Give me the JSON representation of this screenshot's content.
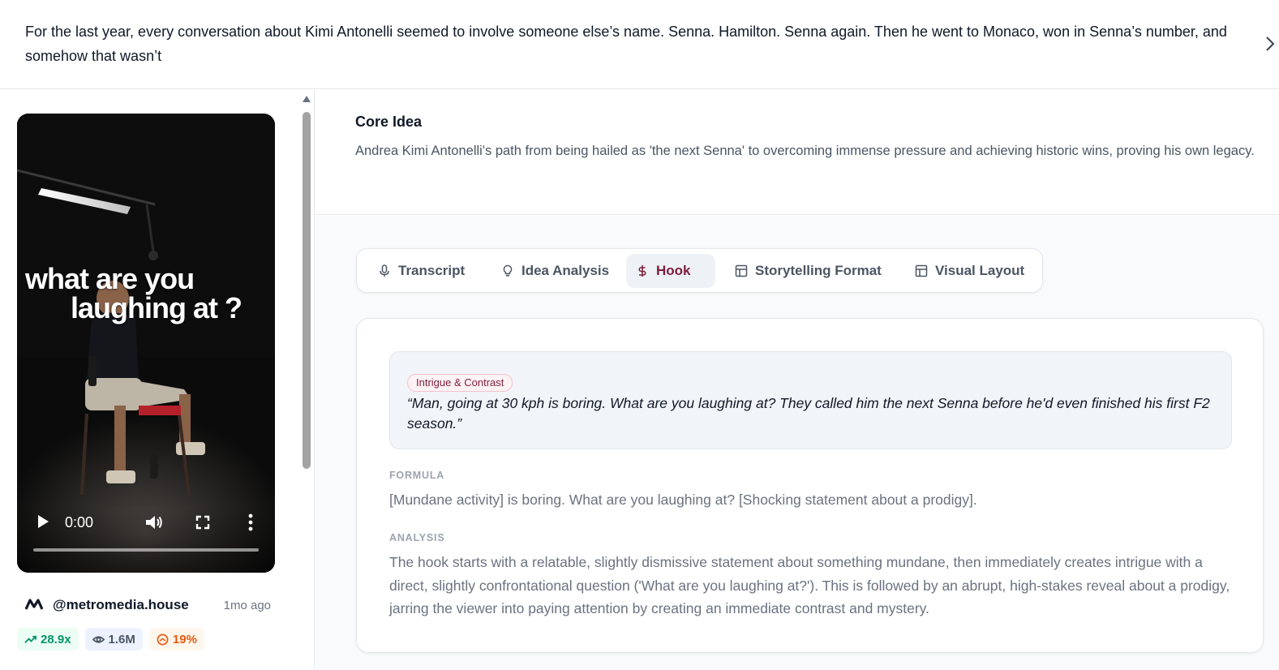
{
  "header": {
    "text": "For the last year, every conversation about Kimi Antonelli seemed to involve someone else’s name. Senna. Hamilton. Senna again. Then he went to Monaco, won in Senna’s number, and somehow that wasn’t",
    "next_icon": "chevron-right-icon"
  },
  "video": {
    "caption_line1": "what are you",
    "caption_line2": "laughing at ?",
    "time": "0:00",
    "progress": 0,
    "icons": [
      "play-icon",
      "volume-icon",
      "fullscreen-icon",
      "more-vertical-icon"
    ]
  },
  "author": {
    "handle": "@metromedia.house",
    "posted": "1mo ago",
    "icon": "brand-logo-icon"
  },
  "stats": {
    "multiplier": "28.9x",
    "views": "1.6M",
    "engagement": "19%",
    "colors": {
      "multiplier": "#059669",
      "views": "#4b5563",
      "engagement": "#ea580c"
    }
  },
  "core_idea": {
    "title": "Core Idea",
    "text": "Andrea Kimi Antonelli's path from being hailed as 'the next Senna' to overcoming immense pressure and achieving historic wins, proving his own legacy."
  },
  "tabs": [
    {
      "label": "Transcript",
      "icon": "mic-icon",
      "active": false
    },
    {
      "label": "Idea Analysis",
      "icon": "lightbulb-icon",
      "active": false
    },
    {
      "label": "Hook",
      "icon": "dollar-icon",
      "active": true
    },
    {
      "label": "Storytelling Format",
      "icon": "layout-icon",
      "active": false
    },
    {
      "label": "Visual Layout",
      "icon": "layout-icon",
      "active": false
    }
  ],
  "hook": {
    "tag": "Intrigue & Contrast",
    "quote": "“Man, going at 30 kph is boring. What are you laughing at? They called him the next Senna before he'd even finished his first F2 season.”",
    "formula_label": "FORMULA",
    "formula": "[Mundane activity] is boring. What are you laughing at? [Shocking statement about a prodigy].",
    "analysis_label": "ANALYSIS",
    "analysis": "The hook starts with a relatable, slightly dismissive statement about something mundane, then immediately creates intrigue with a direct, slightly confrontational question ('What are you laughing at?'). This is followed by an abrupt, high-stakes reveal about a prodigy, jarring the viewer into paying attention by creating an immediate contrast and mystery."
  },
  "accent_color": "#7f1d3a"
}
